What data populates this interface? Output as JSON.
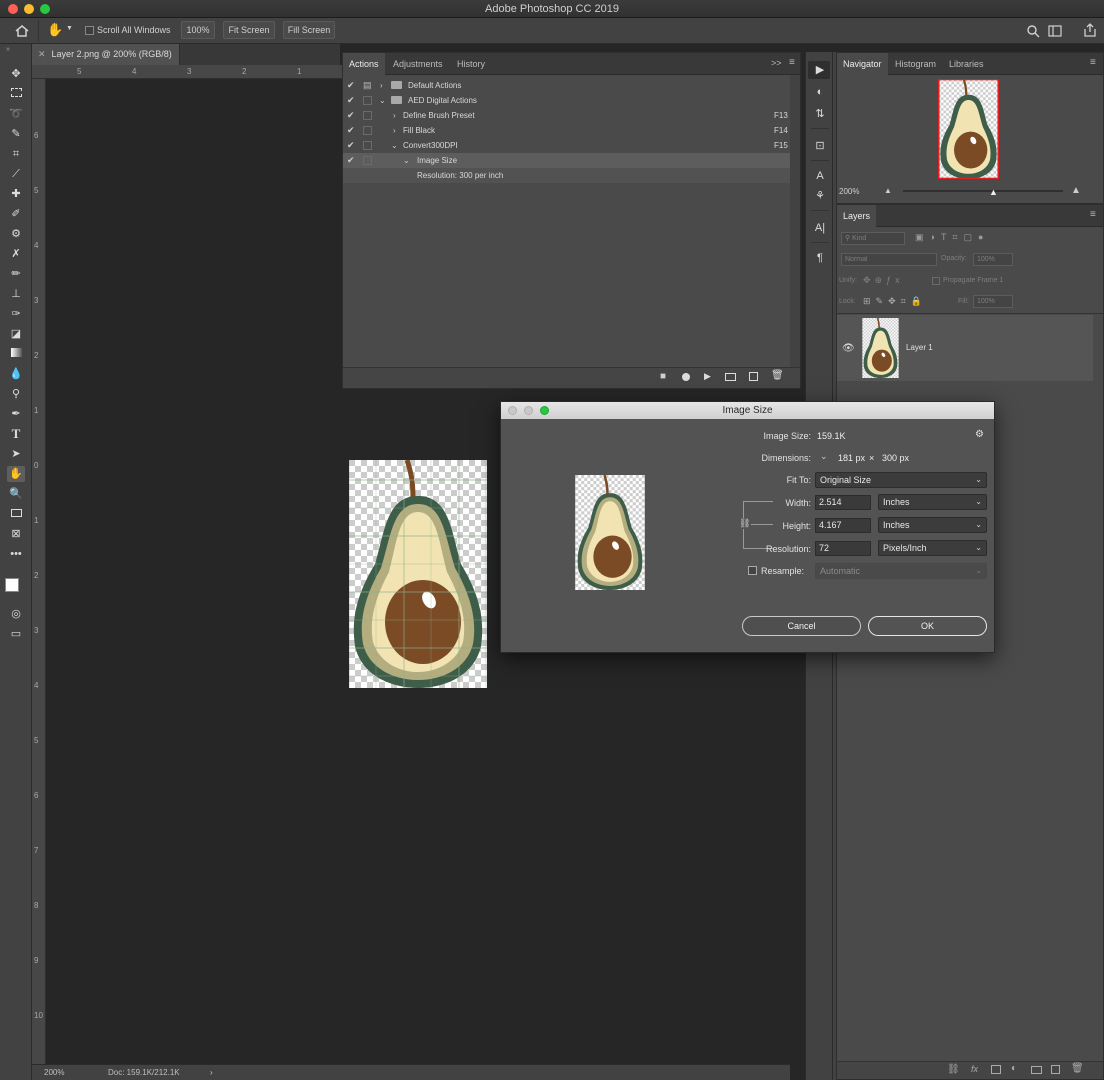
{
  "window": {
    "title": "Adobe Photoshop CC 2019"
  },
  "options_bar": {
    "scroll_all_windows": "Scroll All Windows",
    "zoom_button": "100%",
    "fit_screen": "Fit Screen",
    "fill_screen": "Fill Screen"
  },
  "document": {
    "tab_title": "Layer 2.png @ 200% (RGB/8)",
    "hruler": [
      "5",
      "4",
      "3",
      "2",
      "1"
    ],
    "vruler": [
      "6",
      "5",
      "4",
      "3",
      "2",
      "1",
      "0",
      "1",
      "2",
      "3",
      "4",
      "5",
      "6",
      "7",
      "8",
      "9",
      "10"
    ],
    "zoom": "200%",
    "doc_size": "Doc: 159.1K/212.1K"
  },
  "actions_panel": {
    "tabs": [
      "Actions",
      "Adjustments",
      "History"
    ],
    "rows": [
      {
        "label": "Default Actions",
        "shortcut": ""
      },
      {
        "label": "AED Digital Actions",
        "shortcut": ""
      },
      {
        "label": "Define Brush Preset",
        "shortcut": "F13"
      },
      {
        "label": "Fill Black",
        "shortcut": "F14"
      },
      {
        "label": "Convert300DPI",
        "shortcut": "F15"
      },
      {
        "label": "Image Size",
        "shortcut": ""
      },
      {
        "label": "Resolution: 300 per inch",
        "shortcut": ""
      }
    ]
  },
  "navigator_panel": {
    "tabs": [
      "Navigator",
      "Histogram",
      "Libraries"
    ],
    "zoom": "200%"
  },
  "layers_panel": {
    "tab": "Layers",
    "kind": "Kind",
    "blend_mode": "Normal",
    "opacity_label": "Opacity:",
    "opacity_value": "100%",
    "unify_label": "Unify:",
    "propagate": "Propagate Frame 1",
    "lock_label": "Lock:",
    "fill_label": "Fill:",
    "fill_value": "100%",
    "layer_name": "Layer 1"
  },
  "image_size_dialog": {
    "title": "Image Size",
    "image_size_label": "Image Size:",
    "image_size_value": "159.1K",
    "dimensions_label": "Dimensions:",
    "dim_w": "181 px",
    "dim_x": "×",
    "dim_h": "300 px",
    "fit_to_label": "Fit To:",
    "fit_to_value": "Original Size",
    "width_label": "Width:",
    "width_value": "2.514",
    "width_unit": "Inches",
    "height_label": "Height:",
    "height_value": "4.167",
    "height_unit": "Inches",
    "resolution_label": "Resolution:",
    "resolution_value": "72",
    "resolution_unit": "Pixels/Inch",
    "resample_label": "Resample:",
    "resample_value": "Automatic",
    "cancel": "Cancel",
    "ok": "OK"
  }
}
